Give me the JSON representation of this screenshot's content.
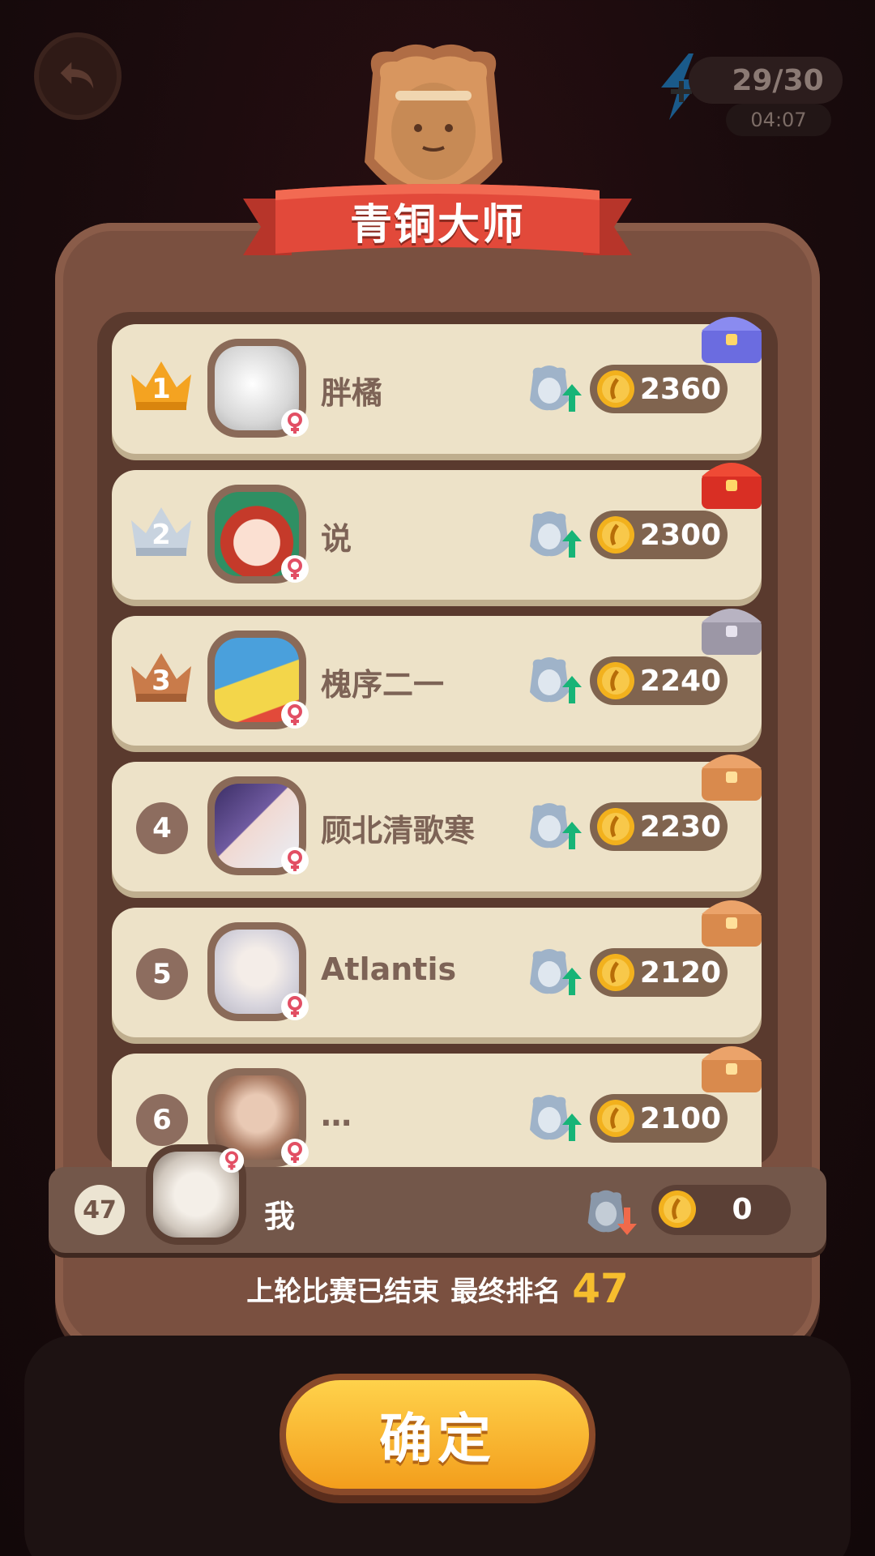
{
  "energy": {
    "count": "29/30",
    "timer": "04:07"
  },
  "league": {
    "title": "青铜大师"
  },
  "rows": [
    {
      "rank": "1",
      "name": "胖橘",
      "score": "2360",
      "crown": "gold",
      "chest": "purple"
    },
    {
      "rank": "2",
      "name": "说",
      "score": "2300",
      "crown": "silver",
      "chest": "red"
    },
    {
      "rank": "3",
      "name": "槐序二一",
      "score": "2240",
      "crown": "bronze",
      "chest": "gray"
    },
    {
      "rank": "4",
      "name": "顾北清歌寒",
      "score": "2230",
      "crown": "",
      "chest": "brown"
    },
    {
      "rank": "5",
      "name": "Atlantis",
      "score": "2120",
      "crown": "",
      "chest": "brown"
    },
    {
      "rank": "6",
      "name": "…",
      "score": "2100",
      "crown": "",
      "chest": "brown"
    }
  ],
  "me": {
    "rank": "47",
    "name": "我",
    "score": "0"
  },
  "footer": {
    "ended": "上轮比赛已结束",
    "final_label": "最终排名",
    "final_rank": "47"
  },
  "confirm_label": "确定",
  "colors": {
    "gold": "#f4a321",
    "silver": "#c8d3df",
    "bronze": "#c97b4a",
    "accent": "#f6be2e",
    "ribbon": "#e2493a"
  }
}
